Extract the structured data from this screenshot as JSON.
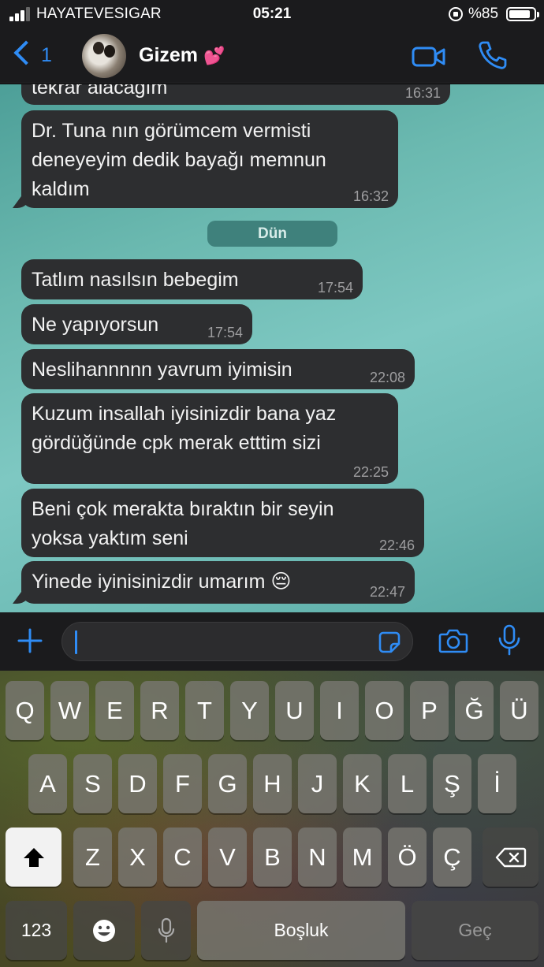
{
  "status_bar": {
    "carrier": "HAYATEVESIGAR",
    "time": "05:21",
    "battery_pct": "%85",
    "battery_level": 0.85,
    "signal_bars": 3
  },
  "header": {
    "back_count": "1",
    "contact_name": "Gizem",
    "contact_emoji": "💕",
    "icons": [
      "back-chevron-icon",
      "video-call-icon",
      "phone-icon"
    ]
  },
  "chat": {
    "date_separator": "Dün",
    "messages": [
      {
        "text": "tekrar alacağım",
        "time": "16:31"
      },
      {
        "text": "Dr. Tuna nın görümcem vermisti\ndeneyeyim dedik bayağı  memnun\nkaldım",
        "time": "16:32"
      },
      {
        "text": "Tatlım  nasılsın  bebegim",
        "time": "17:54"
      },
      {
        "text": "Ne yapıyorsun",
        "time": "17:54"
      },
      {
        "text": "Neslihannnnn yavrum iyimisin",
        "time": "22:08"
      },
      {
        "text": "Kuzum insallah iyisinizdir bana yaz\ngördüğünde  cpk merak etttim sizi",
        "time": "22:25"
      },
      {
        "text": "Beni çok  merakta bıraktın  bir seyin\nyoksa yaktım  seni",
        "time": "22:46"
      },
      {
        "text": "Yinede iyinisinizdir umarım 😔",
        "time": "22:47"
      }
    ]
  },
  "input_bar": {
    "message_value": "",
    "icons": [
      "plus-icon",
      "sticker-icon",
      "camera-icon",
      "microphone-icon"
    ]
  },
  "keyboard": {
    "row1": [
      "Q",
      "W",
      "E",
      "R",
      "T",
      "Y",
      "U",
      "I",
      "O",
      "P",
      "Ğ",
      "Ü"
    ],
    "row2": [
      "A",
      "S",
      "D",
      "F",
      "G",
      "H",
      "J",
      "K",
      "L",
      "Ş",
      "İ"
    ],
    "row3": [
      "Z",
      "X",
      "C",
      "V",
      "B",
      "N",
      "M",
      "Ö",
      "Ç"
    ],
    "numbers_key": "123",
    "space_key": "Boşluk",
    "return_key": "Geç",
    "icons": [
      "shift-icon",
      "delete-icon",
      "emoji-icon",
      "dictation-icon"
    ]
  },
  "colors": {
    "accent": "#2f8cf5",
    "bubble": "#2d2e30",
    "chat_bg": "#6bb9b0",
    "date_pill": "#3f817c"
  }
}
